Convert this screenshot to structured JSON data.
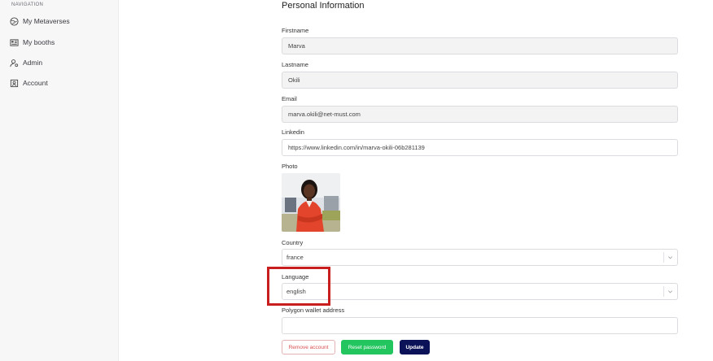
{
  "sidebar": {
    "heading": "NAVIGATION",
    "items": [
      {
        "label": "My Metaverses",
        "icon": "globe-icon"
      },
      {
        "label": "My booths",
        "icon": "booth-icon"
      },
      {
        "label": "Admin",
        "icon": "user-gear-icon"
      },
      {
        "label": "Account",
        "icon": "account-icon"
      }
    ]
  },
  "form": {
    "title": "Personal Information",
    "firstname": {
      "label": "Firstname",
      "value": "Marva"
    },
    "lastname": {
      "label": "Lastname",
      "value": "Okili"
    },
    "email": {
      "label": "Email",
      "value": "marva.okili@net-must.com"
    },
    "linkedin": {
      "label": "Linkedin",
      "value": "https://www.linkedin.com/in/marva-okili-06b281139"
    },
    "photo": {
      "label": "Photo"
    },
    "country": {
      "label": "Country",
      "value": "france"
    },
    "language": {
      "label": "Language",
      "value": "english"
    },
    "wallet": {
      "label": "Polygon wallet address",
      "value": ""
    }
  },
  "buttons": {
    "remove": "Remove account",
    "reset": "Reset password",
    "update": "Update"
  },
  "colors": {
    "highlight": "#c81e1e",
    "reset": "#22c55e",
    "update": "#0b1258",
    "remove_text": "#d94f4f"
  }
}
